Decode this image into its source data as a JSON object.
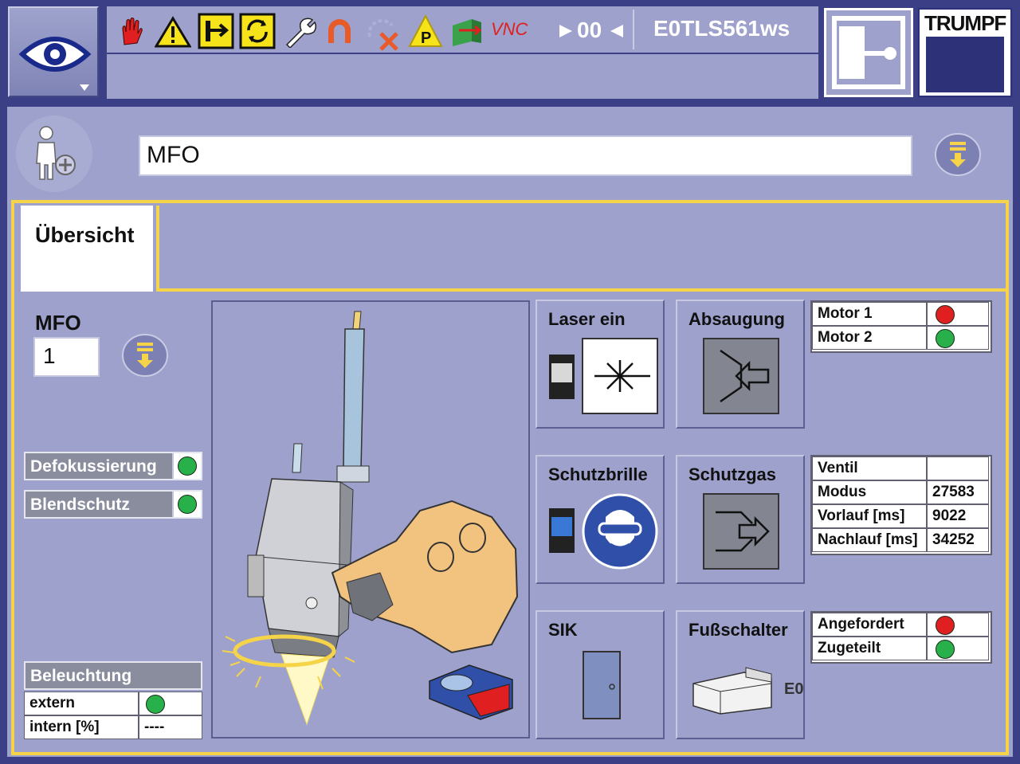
{
  "header": {
    "hostname": "E0TLS561ws",
    "counter": "00",
    "vnc_label": "VNC",
    "brand": "TRUMPF"
  },
  "title_field": {
    "value": "MFO"
  },
  "tabs": [
    {
      "label": "Übersicht"
    }
  ],
  "mfo": {
    "label": "MFO",
    "value": "1"
  },
  "toggles": [
    {
      "label": "Defokussierung",
      "state": "green"
    },
    {
      "label": "Blendschutz",
      "state": "green"
    }
  ],
  "beleuchtung": {
    "title": "Beleuchtung",
    "rows": [
      {
        "label": "extern",
        "value": ""
      },
      {
        "label": "intern [%]",
        "value": "----"
      }
    ]
  },
  "tiles": {
    "laser_ein": "Laser ein",
    "absaugung": "Absaugung",
    "schutzbrille": "Schutzbrille",
    "schutzgas": "Schutzgas",
    "sik": "SIK",
    "fussschalter": "Fußschalter",
    "fussschalter_tag": "E0"
  },
  "motors": [
    {
      "label": "Motor 1",
      "state": "red"
    },
    {
      "label": "Motor 2",
      "state": "green"
    }
  ],
  "gas": [
    {
      "label": "Ventil",
      "value": ""
    },
    {
      "label": "Modus",
      "value": "27583"
    },
    {
      "label": "Vorlauf [ms]",
      "value": "9022"
    },
    {
      "label": "Nachlauf [ms]",
      "value": "34252"
    }
  ],
  "request": [
    {
      "label": "Angefordert",
      "state": "red"
    },
    {
      "label": "Zugeteilt",
      "state": "green"
    }
  ],
  "colors": {
    "accent": "#f6d44a",
    "frame": "#3a3f86",
    "panel": "#9da1cb",
    "ok": "#28b04a",
    "alarm": "#e02020"
  }
}
